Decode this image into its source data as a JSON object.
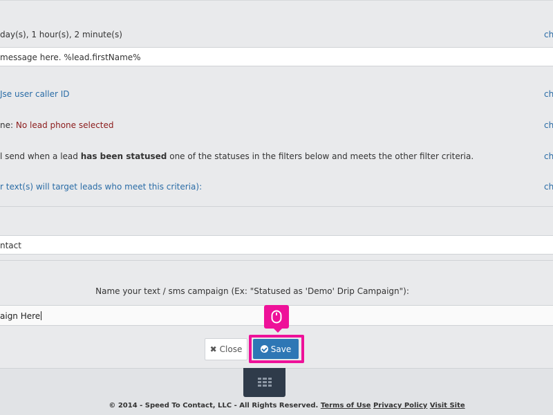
{
  "rows": {
    "interval": {
      "text": "day(s), 1 hour(s), 2 minute(s)",
      "link": "ch"
    },
    "message_value": "message here. %lead.firstName%",
    "caller": {
      "text": "Jse user caller ID",
      "link": "ch"
    },
    "phone": {
      "prefix": "ne: ",
      "value": "No lead phone selected",
      "link": "ch"
    },
    "trigger": {
      "before": "l send when a lead ",
      "bold": "has been statused",
      "after": " one of the statuses in the filters below and meets the other filter criteria.",
      "link": "ch"
    },
    "target": {
      "text": "r text(s) will target leads who meet this criteria):",
      "link": "ch"
    }
  },
  "contact_field_value": "ntact",
  "campaign": {
    "label": "Name your text / sms campaign (Ex: \"Statused as 'Demo' Drip Campaign\"):",
    "value": "aign Here"
  },
  "buttons": {
    "close": "Close",
    "save": "Save"
  },
  "icons": {
    "close": "x-icon",
    "save": "check-circle-icon",
    "cursor": "mouse-icon",
    "menu": "grid-icon"
  },
  "footer": {
    "copyright": "© 2014 - Speed To Contact, LLC - All Rights Reserved.",
    "terms": "Terms of Use",
    "privacy": "Privacy Policy",
    "visit": "Visit Site"
  },
  "colors": {
    "accent": "#2e77b5",
    "highlight": "#ee1199",
    "link": "#2a6ca6",
    "warning_text": "#8b1a1a"
  }
}
